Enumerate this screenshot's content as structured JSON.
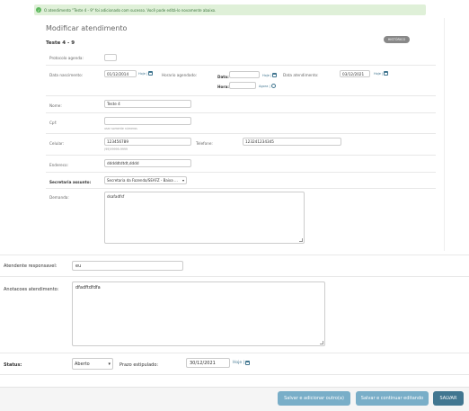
{
  "message": {
    "text": "O atendimento \"Teste 4 - 9\" foi adicionado com sucesso. Você pode editá-lo novamente abaixo."
  },
  "header": {
    "title": "Modificar atendimento",
    "object_name": "Teste 4 - 9",
    "history_button": "HISTÓRICO"
  },
  "fields": {
    "protocolo": {
      "label": "Protocolo agenda:",
      "value": ""
    },
    "data_nascimento": {
      "label": "Data nascimento:",
      "value": "01/12/2014",
      "today_link": "Hoje |"
    },
    "horario_agendado": {
      "label": "Horario agendado:",
      "date_label": "Data:",
      "date_value": "",
      "date_today": "Hoje |",
      "time_label": "Hora:",
      "time_value": "",
      "time_now": "Agora |"
    },
    "data_atendimento": {
      "label": "Data atendimento:",
      "value": "03/12/2021",
      "today_link": "Hoje |"
    },
    "nome": {
      "label": "Nome:",
      "value": "Teste 4"
    },
    "cpf": {
      "label": "Cpf:",
      "value": "",
      "help": "usar somente números"
    },
    "celular": {
      "label": "Celular:",
      "value": "123456789",
      "help": "(99)99999-9999"
    },
    "telefone": {
      "label": "Telefone:",
      "value": "123241234345"
    },
    "endereco": {
      "label": "Endereco:",
      "value": "dddddtdtdt,dddd"
    },
    "secretaria": {
      "label": "Secretaria assunto:",
      "value": "Secretaria da Fazenda/SEAFZ - Baixa ..."
    },
    "demanda": {
      "label": "Demanda:",
      "value": "dsafadfsf"
    }
  },
  "lower": {
    "atendente": {
      "label": "Atendente responsavel:",
      "value": "eu"
    },
    "anotacoes": {
      "label": "Anotacoes atendimento:",
      "value": "dfadftdfdfa"
    },
    "status": {
      "label": "Status:",
      "value": "Aberto"
    },
    "prazo": {
      "label": "Prazo estipulado:",
      "value": "30/12/2021",
      "today_link": "Hoje |"
    }
  },
  "footer": {
    "save_add": "Salvar e adicionar outro(a)",
    "save_continue": "Salvar e continuar editando",
    "save": "SALVAR"
  },
  "colors": {
    "success_bg": "#dff0d8",
    "button_light": "#79aec8",
    "button_dark": "#417690"
  }
}
